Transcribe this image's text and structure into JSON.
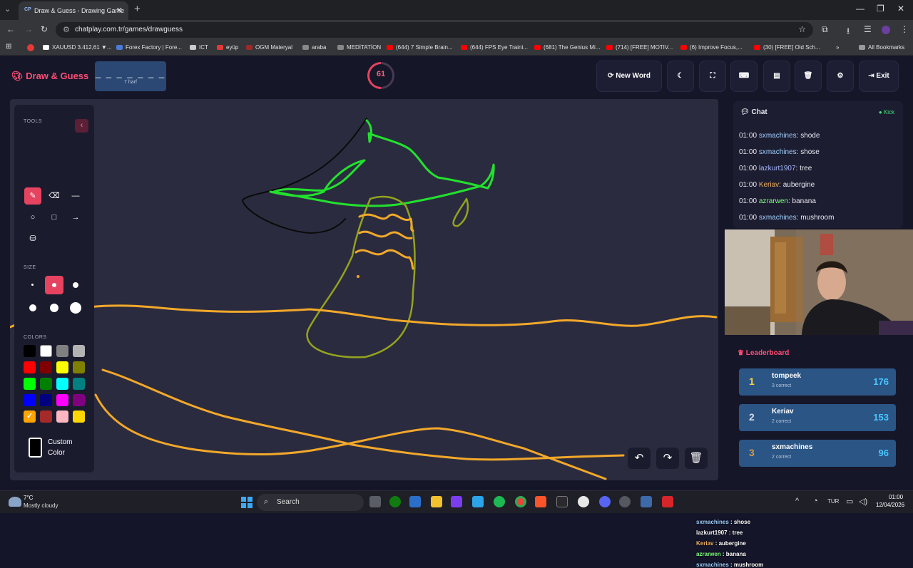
{
  "browser": {
    "tab_title": "Draw & Guess - Drawing Game",
    "tab_icon_text": "CP",
    "url": "chatplay.com.tr/games/drawguess",
    "bookmarks": [
      {
        "label": "XAUUSD 3.412,61 ▼...",
        "color": "#ffffff"
      },
      {
        "label": "Forex Factory | Fore...",
        "color": "#4b7bd8"
      },
      {
        "label": "ICT",
        "color": "#cccccc"
      },
      {
        "label": "eyüp",
        "color": "#e53935"
      },
      {
        "label": "OGM Materyal",
        "color": "#9c2a2a"
      },
      {
        "label": "araba",
        "color": "#888888"
      },
      {
        "label": "MEDİTATİON",
        "color": "#888888"
      },
      {
        "label": "(644) 7 Simple Brain...",
        "color": "#ff0000"
      },
      {
        "label": "(644) FPS Eye Traini...",
        "color": "#ff0000"
      },
      {
        "label": "(681) The Genius Mi...",
        "color": "#ff0000"
      },
      {
        "label": "(714) [FREE] MOTIV...",
        "color": "#ff0000"
      },
      {
        "label": "(6) Improve Focus,...",
        "color": "#ff0000"
      },
      {
        "label": "(30) [FREE] Old Sch...",
        "color": "#ff0000"
      }
    ],
    "all_bookmarks": "All Bookmarks"
  },
  "header": {
    "logo": "Draw & Guess",
    "word_dashes": "_ _ _ _ _ _ _",
    "word_hint": "7 harf",
    "timer": "61",
    "new_word": "New Word",
    "exit": "Exit"
  },
  "tools": {
    "tools_label": "TOOLS",
    "size_label": "SIZE",
    "colors_label": "COLORS",
    "custom_color": "Custom Color",
    "palette": [
      "#000000",
      "#ffffff",
      "#808080",
      "#b3b3b3",
      "#ff0000",
      "#800000",
      "#ffff00",
      "#808000",
      "#00ff00",
      "#008000",
      "#00ffff",
      "#008080",
      "#0000ff",
      "#000080",
      "#ff00ff",
      "#800080",
      "#ffa500",
      "#a52a2a",
      "#ffb6c1",
      "#ffd700"
    ]
  },
  "chat": {
    "title": "Chat",
    "kick": "Kick",
    "messages": [
      {
        "time": "01:00",
        "user": "sxmachines",
        "text": "shode",
        "color": "#9fd0ff"
      },
      {
        "time": "01:00",
        "user": "sxmachines",
        "text": "shose",
        "color": "#9fd0ff"
      },
      {
        "time": "01:00",
        "user": "lazkurt1907",
        "text": "tree",
        "color": "#a5b8ff"
      },
      {
        "time": "01:00",
        "user": "Keriav",
        "text": "aubergine",
        "color": "#f0b060"
      },
      {
        "time": "01:00",
        "user": "azrarwen",
        "text": "banana",
        "color": "#7dff7d"
      },
      {
        "time": "01:00",
        "user": "sxmachines",
        "text": "mushroom",
        "color": "#9fd0ff"
      }
    ]
  },
  "leaderboard": {
    "title": "Leaderboard",
    "rows": [
      {
        "rank": "1",
        "name": "tompeek",
        "sub": "3 correct",
        "score": "176",
        "rank_color": "#ffd23f"
      },
      {
        "rank": "2",
        "name": "Keriav",
        "sub": "2 correct",
        "score": "153",
        "rank_color": "#d7dce6"
      },
      {
        "rank": "3",
        "name": "sxmachines",
        "sub": "2 correct",
        "score": "96",
        "rank_color": "#d69a4a"
      }
    ]
  },
  "overlay_chat": [
    {
      "user": "sxmachines",
      "text": "shose",
      "color": "#9fd0ff"
    },
    {
      "user": "lazkurt1907",
      "text": "tree",
      "color": "#ffffff"
    },
    {
      "user": "Keriav",
      "text": "aubergine",
      "color": "#f0b060"
    },
    {
      "user": "azrarwen",
      "text": "banana",
      "color": "#7dff7d"
    },
    {
      "user": "sxmachines",
      "text": "mushroom",
      "color": "#9fd0ff"
    }
  ],
  "taskbar": {
    "weather_temp": "7°C",
    "weather_desc": "Mostly cloudy",
    "search": "Search",
    "lang": "TUR",
    "time": "01:00",
    "date": "12/04/2026"
  }
}
